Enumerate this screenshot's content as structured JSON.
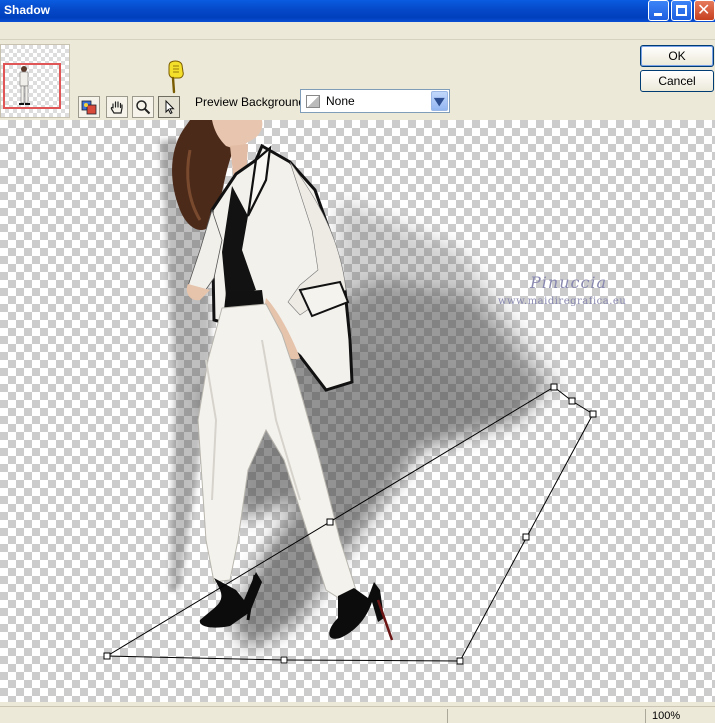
{
  "window": {
    "title": "Shadow"
  },
  "dialog_buttons": {
    "ok_label": "OK",
    "cancel_label": "Cancel"
  },
  "toolbar": {
    "tools": [
      {
        "name": "preview-tool",
        "icon": "color-swatch-icon",
        "active": false
      },
      {
        "name": "pan-tool",
        "icon": "hand-icon",
        "active": false
      },
      {
        "name": "zoom-tool",
        "icon": "magnifier-icon",
        "active": false
      },
      {
        "name": "pick-tool",
        "icon": "arrow-pointer-icon",
        "active": true
      }
    ],
    "pointer_hint_icon": "pointing-hand-icon",
    "preview_background_label": "Preview Background:",
    "preview_background_value": "None"
  },
  "canvas": {
    "watermark_title": "Pinuccia",
    "watermark_url": "www.maidiregrafica.eu"
  },
  "status_bar": {
    "zoom": "100%"
  },
  "colors": {
    "titlebar": "#0548c8",
    "selection_frame": "#e05555",
    "watermark": "#8888b0"
  }
}
